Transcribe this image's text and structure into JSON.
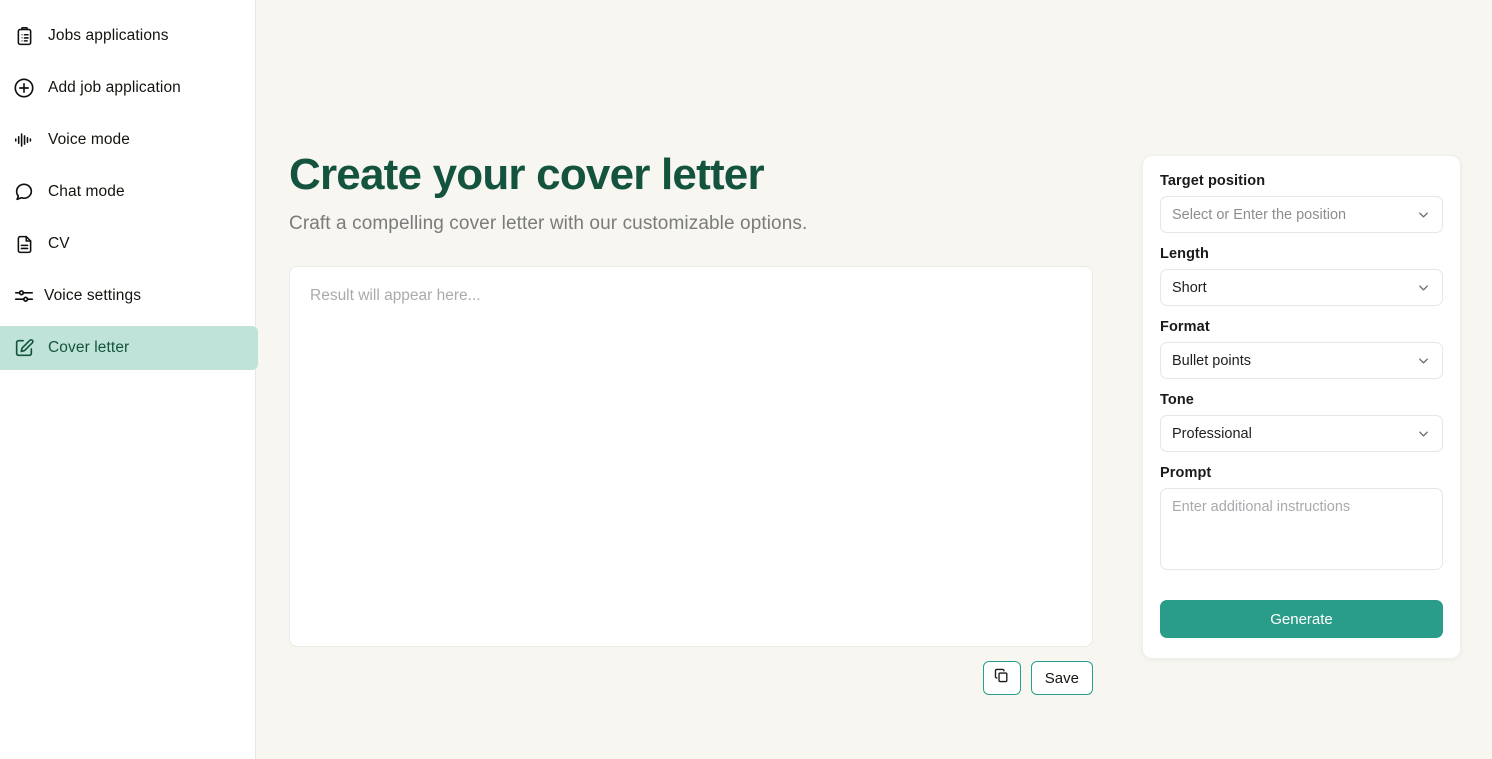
{
  "theme": {
    "accent_teal": "#2a9d8a",
    "dark_green": "#14543e",
    "active_nav_bg": "#bfe3d8",
    "page_bg": "#f7f6f1",
    "sidebar_bg": "#ffffff"
  },
  "sidebar": {
    "items": [
      {
        "label": "Jobs applications",
        "icon": "clipboard-list-icon",
        "active": false
      },
      {
        "label": "Add job application",
        "icon": "plus-circle-icon",
        "active": false
      },
      {
        "label": "Voice mode",
        "icon": "audio-waveform-icon",
        "active": false
      },
      {
        "label": "Chat mode",
        "icon": "chat-bubble-icon",
        "active": false
      },
      {
        "label": "CV",
        "icon": "document-text-icon",
        "active": false
      },
      {
        "label": "Voice settings",
        "icon": "sliders-icon",
        "active": false
      },
      {
        "label": "Cover letter",
        "icon": "pencil-square-icon",
        "active": true
      }
    ]
  },
  "main": {
    "title": "Create your cover letter",
    "subtitle": "Craft a compelling cover letter with our customizable options.",
    "result_placeholder": "Result will appear here...",
    "result_value": "",
    "copy_button_label": "",
    "save_button_label": "Save"
  },
  "panel": {
    "fields": [
      {
        "label": "Target position",
        "value": "Select or Enter the position",
        "is_placeholder": true,
        "type": "select"
      },
      {
        "label": "Length",
        "value": "Short",
        "is_placeholder": false,
        "type": "select"
      },
      {
        "label": "Format",
        "value": "Bullet points",
        "is_placeholder": false,
        "type": "select"
      },
      {
        "label": "Tone",
        "value": "Professional",
        "is_placeholder": false,
        "type": "select"
      }
    ],
    "prompt_label": "Prompt",
    "prompt_placeholder": "Enter additional instructions",
    "prompt_value": "",
    "generate_label": "Generate"
  }
}
